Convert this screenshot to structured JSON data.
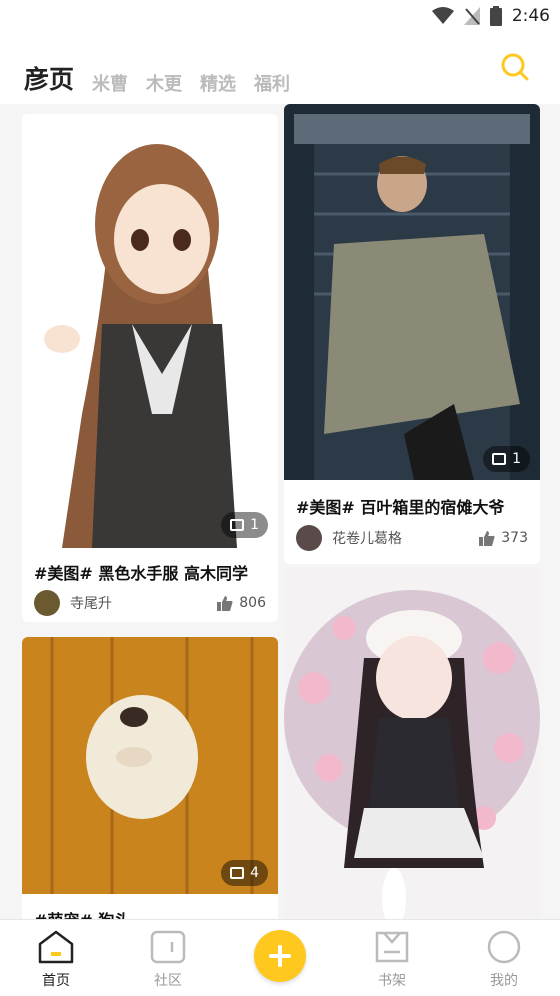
{
  "status_bar": {
    "time": "2:46"
  },
  "header": {
    "tabs": [
      {
        "label": "彦页",
        "active": true
      },
      {
        "label": "米曹"
      },
      {
        "label": "木更"
      },
      {
        "label": "精选"
      },
      {
        "label": "福利"
      }
    ]
  },
  "feed": {
    "posts": [
      {
        "title": "#美图# 黑色水手服 高木同学",
        "author": "寺尾升",
        "likes": "806",
        "image_count": "1"
      },
      {
        "title": "#美图# 百叶箱里的宿傩大爷",
        "author": "花卷儿葛格",
        "likes": "373",
        "image_count": "1"
      },
      {
        "title": "#萌宠# 狗头",
        "author": "",
        "likes": "",
        "image_count": "4"
      },
      {
        "title": "",
        "author": "",
        "likes": "",
        "image_count": ""
      }
    ]
  },
  "tab_bar": {
    "items": [
      {
        "label": "首页",
        "active": true
      },
      {
        "label": "社区"
      },
      {
        "label": "书架"
      },
      {
        "label": "我的"
      }
    ]
  },
  "colors": {
    "accent": "#ffc81f",
    "text": "#222222",
    "muted": "#999999"
  }
}
